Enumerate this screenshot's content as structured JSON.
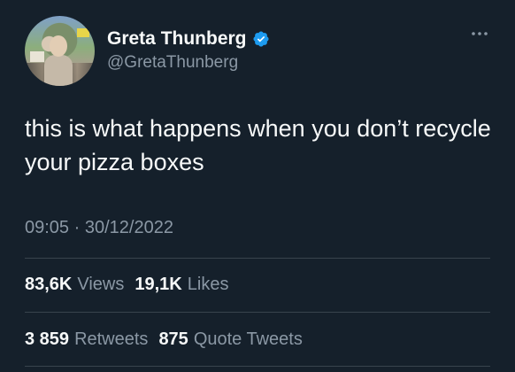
{
  "profile": {
    "display_name": "Greta Thunberg",
    "handle": "@GretaThunberg",
    "verified": true,
    "verified_color": "#1d9bf0"
  },
  "more_icon": "more-horizontal-icon",
  "tweet": {
    "text": "this is what happens when you don’t recycle your pizza boxes",
    "time": "09:05",
    "separator": "·",
    "date": "30/12/2022"
  },
  "stats_row_1": {
    "views_count": "83,6K",
    "views_label": "Views",
    "likes_count": "19,1K",
    "likes_label": "Likes"
  },
  "stats_row_2": {
    "retweets_count": "3 859",
    "retweets_label": "Retweets",
    "quotes_count": "875",
    "quotes_label": "Quote Tweets"
  },
  "colors": {
    "background": "#15202b",
    "text": "#f7f9f9",
    "secondary_text": "#8b98a5",
    "divider": "#38444d"
  }
}
